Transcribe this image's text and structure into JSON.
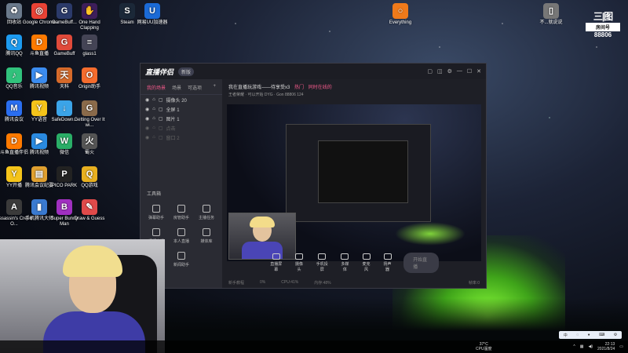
{
  "desktop_icons": [
    {
      "label": "回收站",
      "icon": "recycle-bin-icon",
      "color": "#6b7a8c",
      "glyph": "♻"
    },
    {
      "label": "Google Chrome",
      "icon": "chrome-icon",
      "color": "#e94235",
      "glyph": "◎"
    },
    {
      "label": "GameBuff...",
      "icon": "gamebuff-icon",
      "color": "#2b3a6a",
      "glyph": "G"
    },
    {
      "label": "One Hand Clapping",
      "icon": "game-icon",
      "color": "#3d1e5a",
      "glyph": "✋"
    },
    {
      "label": "Steam",
      "icon": "steam-icon",
      "color": "#1b2838",
      "glyph": "S"
    },
    {
      "label": "网易UU加速器",
      "icon": "uu-icon",
      "color": "#1b6ad6",
      "glyph": "U"
    },
    {
      "label": "Everything",
      "icon": "search-icon",
      "color": "#f07a1a",
      "glyph": "○"
    },
    {
      "label": "不...就说说",
      "icon": "file-icon",
      "color": "#777777",
      "glyph": "▯"
    },
    {
      "label": "腾讯QQ",
      "icon": "qq-icon",
      "color": "#1d9bf0",
      "glyph": "Q"
    },
    {
      "label": "斗鱼直播",
      "icon": "douyu-icon",
      "color": "#ff7a00",
      "glyph": "D"
    },
    {
      "label": "GameBuff",
      "icon": "gamebuff-icon",
      "color": "#e04a3a",
      "glyph": "G"
    },
    {
      "label": "glass1",
      "icon": "file-icon",
      "color": "#444455",
      "glyph": "≡"
    },
    {
      "label": "QQ音乐",
      "icon": "qq-music-icon",
      "color": "#31c27c",
      "glyph": "♪"
    },
    {
      "label": "腾讯视频",
      "icon": "tencent-video-icon",
      "color": "#3b8cf0",
      "glyph": "▶"
    },
    {
      "label": "天科",
      "icon": "game-icon",
      "color": "#d66a2a",
      "glyph": "天"
    },
    {
      "label": "Origin助手",
      "icon": "origin-icon",
      "color": "#f56c2d",
      "glyph": "O"
    },
    {
      "label": "腾讯会议",
      "icon": "meeting-icon",
      "color": "#2a6ef0",
      "glyph": "M"
    },
    {
      "label": "YY语音",
      "icon": "yy-icon",
      "color": "#f5c41a",
      "glyph": "Y"
    },
    {
      "label": "SafeDown...",
      "icon": "download-icon",
      "color": "#3ba4e8",
      "glyph": "↓"
    },
    {
      "label": "Getting Over It wi...",
      "icon": "game-icon",
      "color": "#8a6a4a",
      "glyph": "G"
    },
    {
      "label": "斗鱼直播伴侣",
      "icon": "douyu-icon",
      "color": "#ff7a00",
      "glyph": "D"
    },
    {
      "label": "腾讯视频",
      "icon": "tencent-video-icon",
      "color": "#2a8ae0",
      "glyph": "▶"
    },
    {
      "label": "微信",
      "icon": "wechat-icon",
      "color": "#2aae67",
      "glyph": "W"
    },
    {
      "label": "蜀火",
      "icon": "game-icon",
      "color": "#555555",
      "glyph": "火"
    },
    {
      "label": "YY开播",
      "icon": "yy-icon",
      "color": "#f5c41a",
      "glyph": "Y"
    },
    {
      "label": "腾讯会议纪要",
      "icon": "file-icon",
      "color": "#e0a030",
      "glyph": "▤"
    },
    {
      "label": "PICO PARK",
      "icon": "game-icon",
      "color": "#222222",
      "glyph": "P"
    },
    {
      "label": "QQ游戏",
      "icon": "qq-game-icon",
      "color": "#e8b020",
      "glyph": "Q"
    },
    {
      "label": "Assassin's Creed O...",
      "icon": "game-icon",
      "color": "#3a3a3a",
      "glyph": "A"
    },
    {
      "label": "手机腾讯大师",
      "icon": "phone-icon",
      "color": "#3a7ad0",
      "glyph": "▮"
    },
    {
      "label": "Super Bunny Man",
      "icon": "game-icon",
      "color": "#a030c0",
      "glyph": "B"
    },
    {
      "label": "Draw & Guess",
      "icon": "game-icon",
      "color": "#e04a4a",
      "glyph": "✎"
    }
  ],
  "app": {
    "name": "直播伴侣",
    "version": "新版",
    "left_tabs": [
      "我的场景",
      "场景",
      "可选项"
    ],
    "scenes": [
      {
        "label": "摄像头 20",
        "dim": false
      },
      {
        "label": "全屏 1",
        "dim": false
      },
      {
        "label": "图片 1",
        "dim": false
      },
      {
        "label": "点击",
        "dim": true
      },
      {
        "label": "窗口 2",
        "dim": true
      }
    ],
    "toolbox_title": "工具箱",
    "tools": [
      "弹幕助手",
      "房管助手",
      "主播任务",
      "视频直播",
      "本人直播",
      "媒体库",
      "弹幕包",
      "新闻助手"
    ],
    "stream_title": "我在直播玩游戏——待享受x3",
    "stream_tag": "热门",
    "stream_hot": "同时在线的",
    "stream_meta": "王者荣耀 · 可以开始  DYG · Gon   88806  124",
    "controls": [
      "直播屏幕",
      "摄像头",
      "手机投屏",
      "多媒体",
      "麦克风",
      "扬声器"
    ],
    "start_button": "开始直播",
    "status": [
      "新手教程",
      "0%",
      "CPU:41%",
      "内存:48%",
      "帧率:0"
    ]
  },
  "room": {
    "label": "房间号",
    "number": "88806"
  },
  "tray": {
    "temp": "37°C",
    "weather": "CPU温度",
    "time": "22:13",
    "date": "2021/8/24"
  }
}
